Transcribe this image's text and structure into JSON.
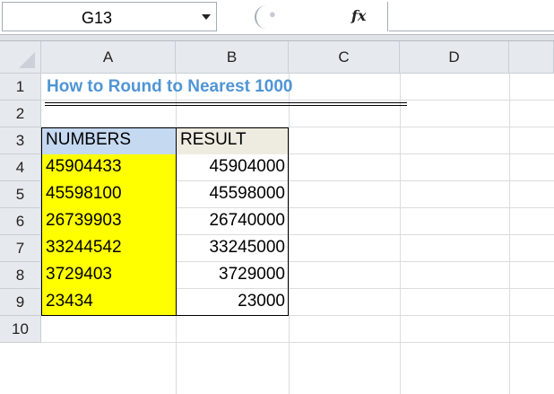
{
  "formula_bar": {
    "name_box": "G13",
    "fx_label": "fx",
    "formula": ""
  },
  "columns": [
    "A",
    "B",
    "C",
    "D"
  ],
  "rows": [
    "1",
    "2",
    "3",
    "4",
    "5",
    "6",
    "7",
    "8",
    "9",
    "10"
  ],
  "sheet": {
    "title": "How to Round to Nearest 1000",
    "headers": {
      "numbers": "NUMBERS",
      "result": "RESULT"
    },
    "data": [
      {
        "number": "45904433",
        "result": "45904000"
      },
      {
        "number": "45598100",
        "result": "45598000"
      },
      {
        "number": "26739903",
        "result": "26740000"
      },
      {
        "number": "33244542",
        "result": "33245000"
      },
      {
        "number": "3729403",
        "result": "3729000"
      },
      {
        "number": "23434",
        "result": "23000"
      }
    ]
  },
  "colors": {
    "title": "#4f95d5",
    "highlight": "#ffff00",
    "numbers_header_fill": "#c5d9f1",
    "result_header_fill": "#eeece1"
  }
}
